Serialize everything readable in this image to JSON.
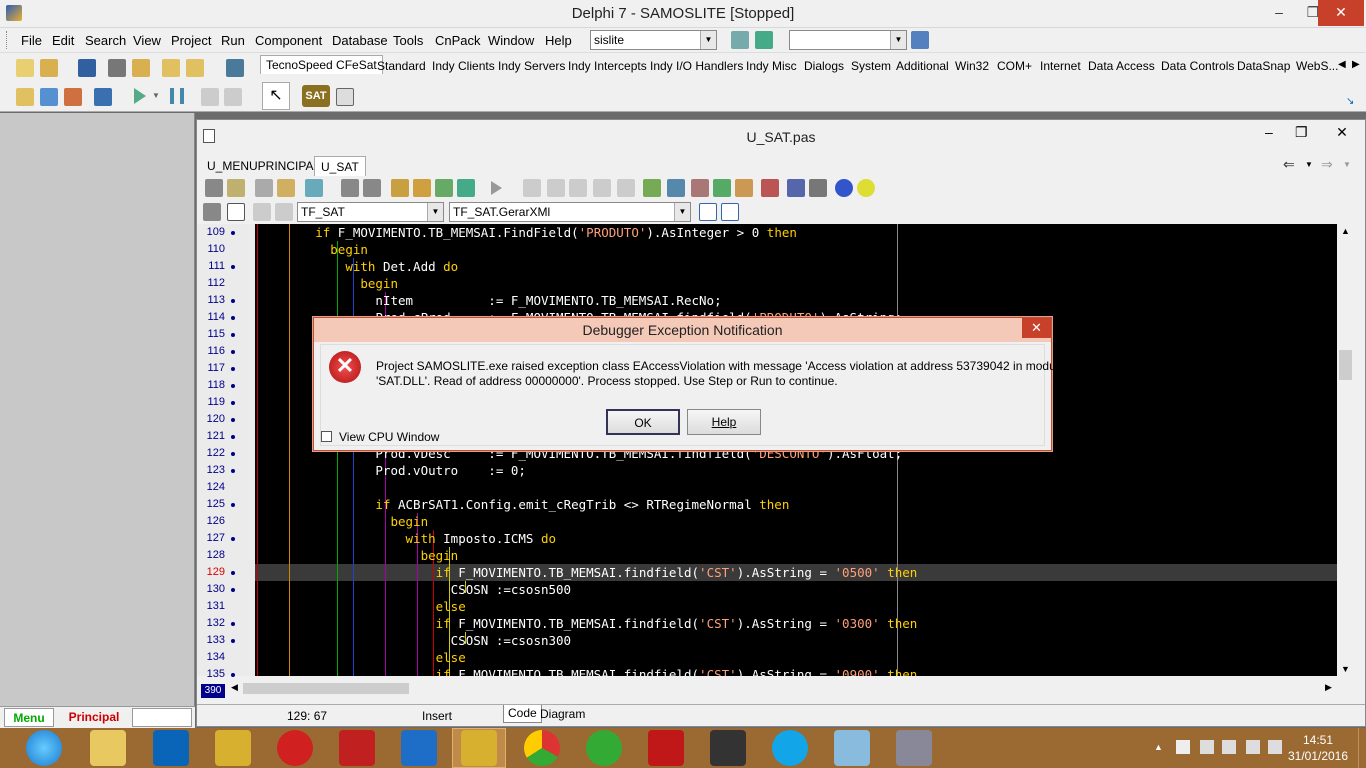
{
  "window": {
    "title": "Delphi 7 - SAMOSLITE [Stopped]"
  },
  "menu": [
    "File",
    "Edit",
    "Search",
    "View",
    "Project",
    "Run",
    "Component",
    "Database",
    "Tools",
    "CnPack",
    "Window",
    "Help"
  ],
  "toolbar": {
    "config_combo": "sislite",
    "second_combo": ""
  },
  "palette_tabs": [
    "TecnoSpeed CFeSat",
    "Standard",
    "Indy Clients",
    "Indy Servers",
    "Indy Intercepts",
    "Indy I/O Handlers",
    "Indy Misc",
    "Dialogs",
    "System",
    "Additional",
    "Win32",
    "COM+",
    "Internet",
    "Data Access",
    "Data Controls",
    "DataSnap",
    "WebS..."
  ],
  "palette_component": "SAT",
  "editor": {
    "title": "U_SAT.pas",
    "tabs": [
      "U_MENUPRINCIPAL",
      "U_SAT"
    ],
    "class_combo": "TF_SAT",
    "method_combo": "TF_SAT.GerarXMl",
    "cursor_pos": "129:  67",
    "mode": "Insert",
    "bottom_tabs": [
      "Code",
      "Diagram"
    ],
    "scroll_line": "390"
  },
  "code_lines": [
    {
      "n": "109",
      "dot": true,
      "t": "        if F_MOVIMENTO.TB_MEMSAI.FindField('PRODUTO').AsInteger > 0 then"
    },
    {
      "n": "110",
      "dot": false,
      "t": "          begin"
    },
    {
      "n": "111",
      "dot": true,
      "t": "            with Det.Add do"
    },
    {
      "n": "112",
      "dot": false,
      "t": "              begin"
    },
    {
      "n": "113",
      "dot": true,
      "t": "                nItem          := F_MOVIMENTO.TB_MEMSAI.RecNo;"
    },
    {
      "n": "114",
      "dot": true,
      "t": "                Prod.cProd     := F_MOVIMENTO.TB_MEMSAI.findfield('PRODUTO').AsString;"
    },
    {
      "n": "115",
      "dot": true,
      "t": ""
    },
    {
      "n": "116",
      "dot": true,
      "t": ""
    },
    {
      "n": "117",
      "dot": true,
      "t": ""
    },
    {
      "n": "118",
      "dot": true,
      "t": ""
    },
    {
      "n": "119",
      "dot": true,
      "t": ""
    },
    {
      "n": "120",
      "dot": true,
      "t": ""
    },
    {
      "n": "121",
      "dot": true,
      "t": ""
    },
    {
      "n": "122",
      "dot": true,
      "t": "                Prod.vDesc     := F_MOVIMENTO.TB_MEMSAI.findfield('DESCONTO').AsFloat;"
    },
    {
      "n": "123",
      "dot": true,
      "t": "                Prod.vOutro    := 0;"
    },
    {
      "n": "124",
      "dot": false,
      "t": ""
    },
    {
      "n": "125",
      "dot": true,
      "t": "                if ACBrSAT1.Config.emit_cRegTrib <> RTRegimeNormal then"
    },
    {
      "n": "126",
      "dot": false,
      "t": "                  begin"
    },
    {
      "n": "127",
      "dot": true,
      "t": "                    with Imposto.ICMS do"
    },
    {
      "n": "128",
      "dot": false,
      "t": "                      begin"
    },
    {
      "n": "129",
      "dot": true,
      "t": "                        if F_MOVIMENTO.TB_MEMSAI.findfield('CST').AsString = '0500' then"
    },
    {
      "n": "130",
      "dot": true,
      "t": "                          CSOSN :=csosn500"
    },
    {
      "n": "131",
      "dot": false,
      "t": "                        else"
    },
    {
      "n": "132",
      "dot": true,
      "t": "                        if F_MOVIMENTO.TB_MEMSAI.findfield('CST').AsString = '0300' then"
    },
    {
      "n": "133",
      "dot": true,
      "t": "                          CSOSN :=csosn300"
    },
    {
      "n": "134",
      "dot": false,
      "t": "                        else"
    },
    {
      "n": "135",
      "dot": true,
      "t": "                        if F_MOVIMENTO.TB_MEMSAI.findfield('CST').AsString = '0900' then"
    }
  ],
  "dialog": {
    "title": "Debugger Exception Notification",
    "message_line1": "Project SAMOSLITE.exe raised exception class EAccessViolation with message 'Access violation at address 53739042 in module",
    "message_line2": "'SAT.DLL'. Read of address 00000000'. Process stopped. Use Step or Run to continue.",
    "ok_label": "OK",
    "help_label": "Help",
    "checkbox_label": "View CPU Window"
  },
  "left_tabs": [
    "Menu",
    "Principal"
  ],
  "clock": {
    "time": "14:51",
    "date": "31/01/2016"
  },
  "colors": {
    "keyword": "#ffd000",
    "string": "#ffa07a",
    "code_bg": "#000000",
    "current_line": "#3a3a3a",
    "taskbar": "#9a6a32"
  }
}
